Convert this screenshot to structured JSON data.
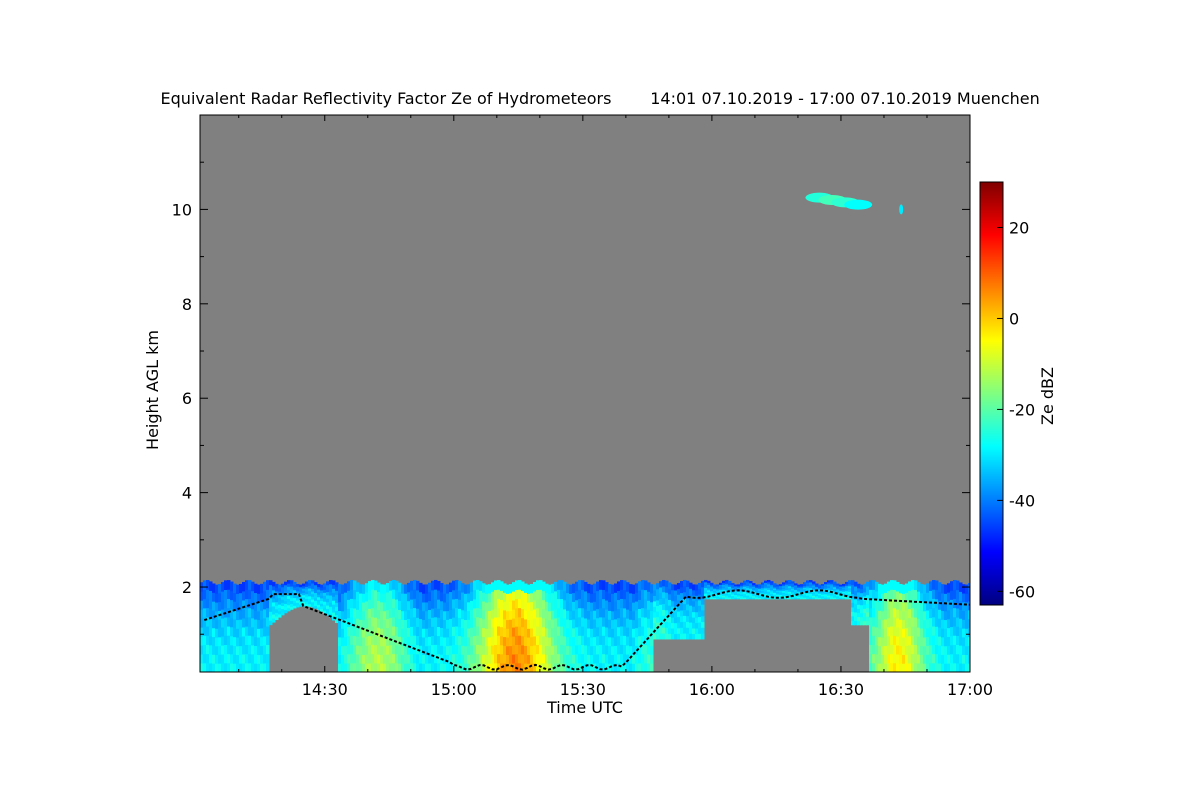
{
  "chart_data": {
    "type": "heatmap",
    "title": "Equivalent Radar Reflectivity Factor Ze of Hydrometeors",
    "subtitle": "14:01 07.10.2019 - 17:00 07.10.2019 Muenchen",
    "xlabel": "Time UTC",
    "ylabel": "Height AGL km",
    "colorbar_label": "Ze dBZ",
    "x_tick_labels": [
      "14:30",
      "15:00",
      "15:30",
      "16:00",
      "16:30",
      "17:00"
    ],
    "x_ticks": [
      870,
      900,
      930,
      960,
      990,
      1020
    ],
    "xlim": [
      841,
      1020
    ],
    "y_ticks": [
      2,
      4,
      6,
      8,
      10
    ],
    "y_tick_labels": [
      "2",
      "4",
      "6",
      "8",
      "10"
    ],
    "ylim": [
      0.2,
      12
    ],
    "colorbar_ticks": [
      -60,
      -40,
      -20,
      0,
      20
    ],
    "colorbar_tick_labels": [
      "-60",
      "-40",
      "-20",
      "0",
      "20"
    ],
    "colorbar_range": [
      -63,
      30
    ],
    "colormap": [
      "#000080",
      "#0000ff",
      "#0080ff",
      "#00ffff",
      "#80ff80",
      "#ffff00",
      "#ff8000",
      "#ff0000",
      "#800000"
    ],
    "background_color": "#808080",
    "grid": false
  }
}
